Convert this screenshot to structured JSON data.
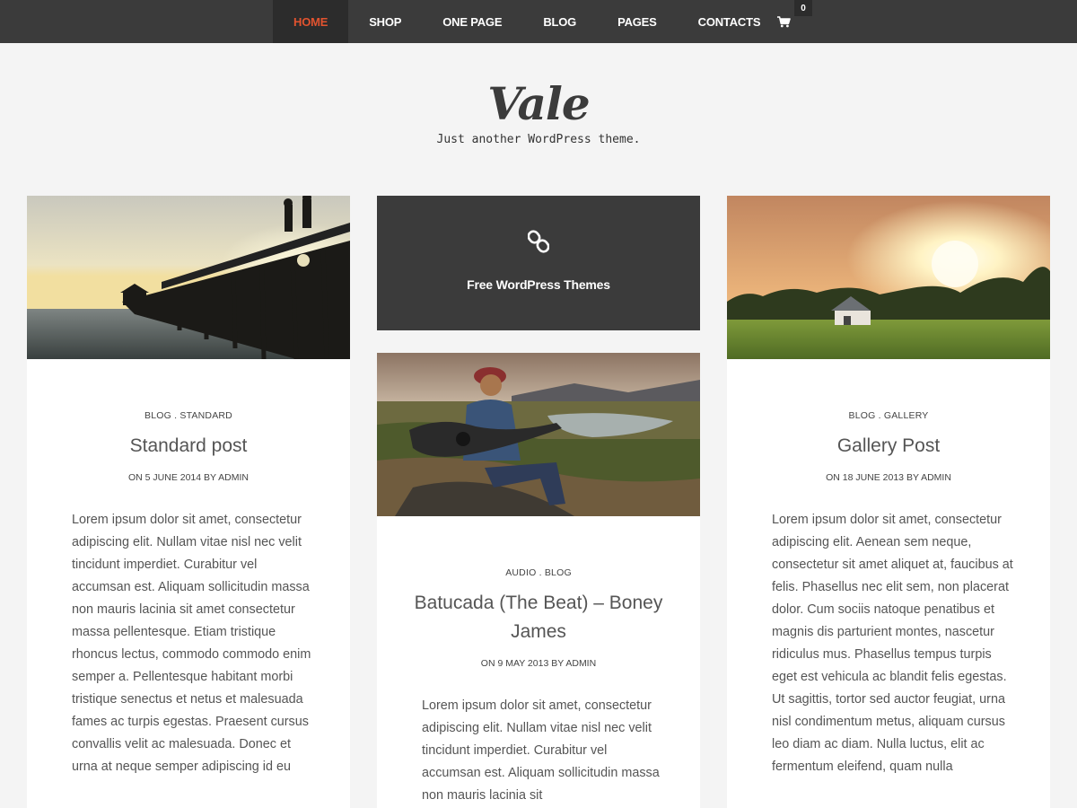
{
  "nav": {
    "items": [
      {
        "label": "HOME",
        "active": true
      },
      {
        "label": "SHOP",
        "active": false
      },
      {
        "label": "ONE PAGE",
        "active": false
      },
      {
        "label": "BLOG",
        "active": false
      },
      {
        "label": "PAGES",
        "active": false
      },
      {
        "label": "CONTACTS",
        "active": false
      }
    ],
    "cart_icon": "shopping-cart-icon",
    "cart_count": "0"
  },
  "site": {
    "title": "Vale",
    "tagline": "Just another WordPress theme."
  },
  "colors": {
    "accent": "#e2532f",
    "nav_bg": "#3b3b3b",
    "page_bg": "#f4f4f4"
  },
  "posts": {
    "standard": {
      "cat1": "BLOG",
      "sep": ".",
      "cat2": "STANDARD",
      "title": "Standard post",
      "meta": "ON 5 JUNE 2014 BY ADMIN",
      "excerpt": "Lorem ipsum dolor sit amet, consectetur adipiscing elit. Nullam vitae nisl nec velit tincidunt imperdiet. Curabitur vel accumsan est. Aliquam sollicitudin massa non mauris lacinia sit amet consectetur massa pellentesque. Etiam tristique rhoncus lectus, commodo commodo enim semper a. Pellentesque habitant morbi tristique senectus et netus et malesuada fames ac turpis egestas. Praesent cursus convallis velit ac malesuada. Donec et urna at neque semper adipiscing id eu"
    },
    "link": {
      "icon": "link-icon",
      "text": "Free WordPress Themes"
    },
    "audio": {
      "cat1": "AUDIO",
      "sep": ".",
      "cat2": "BLOG",
      "title": "Batucada (The Beat) – Boney James",
      "meta": "ON 9 MAY 2013 BY ADMIN",
      "excerpt": "Lorem ipsum dolor sit amet, consectetur adipiscing elit. Nullam vitae nisl nec velit tincidunt imperdiet. Curabitur vel accumsan est. Aliquam sollicitudin massa non mauris lacinia sit"
    },
    "gallery": {
      "cat1": "BLOG",
      "sep": ".",
      "cat2": "GALLERY",
      "title": "Gallery Post",
      "meta": "ON 18 JUNE 2013 BY ADMIN",
      "excerpt": "Lorem ipsum dolor sit amet, consectetur adipiscing elit. Aenean sem neque, consectetur sit amet aliquet at, faucibus at felis. Phasellus nec elit sem, non placerat dolor. Cum sociis natoque penatibus et magnis dis parturient montes, nascetur ridiculus mus. Phasellus tempus turpis eget est vehicula ac blandit felis egestas. Ut sagittis, tortor sed auctor feugiat, urna nisl condimentum metus, aliquam cursus leo diam ac diam. Nulla luctus, elit ac fermentum eleifend, quam nulla"
    }
  }
}
